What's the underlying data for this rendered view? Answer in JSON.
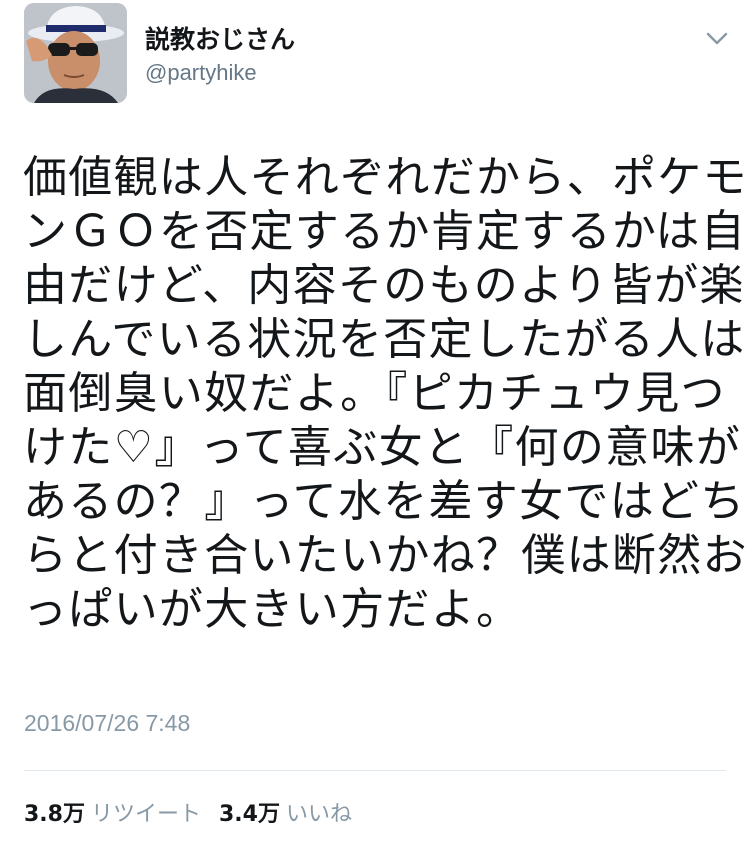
{
  "author": {
    "display_name": "説教おじさん",
    "handle": "@partyhike"
  },
  "tweet": {
    "lines": [
      "価値観は人それぞれだから、ポケモ",
      "ンＧＯを否定するか肯定するかは自",
      "由だけど、内容そのものより皆が楽",
      "しんでいる状況を否定したがる人は",
      "面倒臭い奴だよ。『ピカチュウ見つ",
      "けた♡』って喜ぶ女と『何の意味が",
      "あるの？』って水を差す女ではどち",
      "らと付き合いたいかね？僕は断然お",
      "っぱいが大きい方だよ。"
    ],
    "timestamp": "2016/07/26 7:48"
  },
  "stats": {
    "retweet_count": "3.8万",
    "retweet_label": "リツイート",
    "like_count": "3.4万",
    "like_label": "いいね"
  },
  "icons": {
    "menu": "chevron-down-icon"
  },
  "colors": {
    "text": "#14171a",
    "secondary": "#657786",
    "muted": "#8899a6",
    "divider": "#e1e8ed"
  }
}
